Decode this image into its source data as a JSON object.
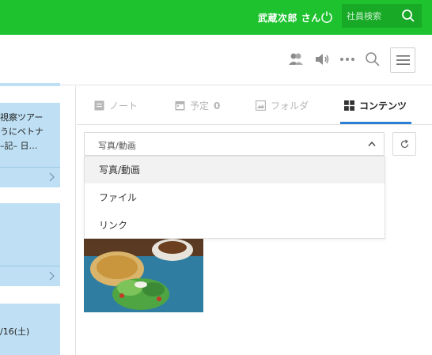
{
  "topbar": {
    "user_name": "武蔵次郎 さん",
    "search_placeholder": "社員検索",
    "brand_color": "#1ec22f"
  },
  "toolbar": {
    "icons": [
      "people-icon",
      "speaker-icon",
      "more-icon",
      "search-icon",
      "menu-icon"
    ]
  },
  "chat": {
    "bubbles": [
      {
        "lines": [
          "視察ツアー",
          "うにベトナ",
          "–記– 日…"
        ],
        "has_link": true
      },
      {
        "lines": [],
        "has_link": true
      },
      {
        "lines": [
          "/16(土)"
        ],
        "has_link": false
      }
    ]
  },
  "tabs": [
    {
      "label": "ノート",
      "icon": "note-icon",
      "active": false
    },
    {
      "label": "予定",
      "count": "0",
      "icon": "calendar-icon",
      "active": false
    },
    {
      "label": "フォルダ",
      "icon": "image-folder-icon",
      "active": false
    },
    {
      "label": "コンテンツ",
      "icon": "grid-icon",
      "active": true
    }
  ],
  "content_select": {
    "selected": "写真/動画",
    "options": [
      "写真/動画",
      "ファイル",
      "リンク"
    ]
  },
  "accent_color": "#2c7fd6"
}
